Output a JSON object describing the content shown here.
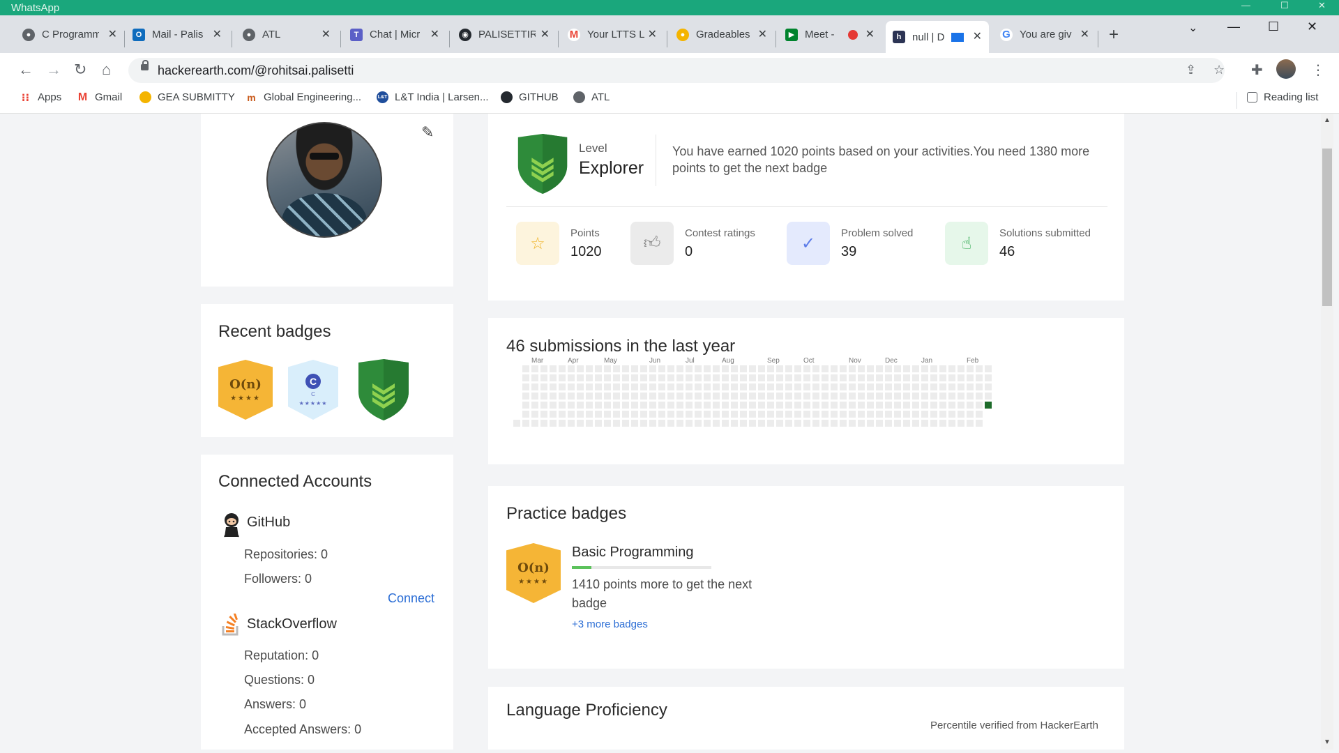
{
  "window": {
    "title_bar_app": "WhatsApp"
  },
  "tabs": [
    {
      "title": "C Programm",
      "favicon": "globe-icon",
      "color": "#5f6368"
    },
    {
      "title": "Mail - Palis",
      "favicon": "outlook-icon",
      "color": "#0f6cbd"
    },
    {
      "title": "ATL",
      "favicon": "globe-icon",
      "color": "#5f6368"
    },
    {
      "title": "Chat | Micr",
      "favicon": "teams-icon",
      "color": "#5b5fc7"
    },
    {
      "title": "PALISETTIR",
      "favicon": "github-icon",
      "color": "#24292f"
    },
    {
      "title": "Your LTTS L",
      "favicon": "gmail-icon",
      "color": "#ea4335"
    },
    {
      "title": "Gradeables",
      "favicon": "duck-icon",
      "color": "#f4b400"
    },
    {
      "title": "Meet -",
      "favicon": "meet-icon",
      "color": "#00832d"
    },
    {
      "title": "null | D",
      "favicon": "hackerearth-icon",
      "color": "#2c3454",
      "active": true
    },
    {
      "title": "You are giv",
      "favicon": "google-icon",
      "color": "#4285f4"
    }
  ],
  "address_bar": {
    "url": "hackerearth.com/@rohitsai.palisetti"
  },
  "bookmarks": [
    {
      "label": "Apps",
      "icon": "apps-grid-icon"
    },
    {
      "label": "Gmail",
      "icon": "gmail-icon"
    },
    {
      "label": "GEA SUBMITTY",
      "icon": "duck-icon"
    },
    {
      "label": "Global Engineering...",
      "icon": "ltts-icon"
    },
    {
      "label": "L&T India | Larsen...",
      "icon": "lt-icon"
    },
    {
      "label": "GITHUB",
      "icon": "github-icon"
    },
    {
      "label": "ATL",
      "icon": "globe-icon"
    }
  ],
  "reading_list": "Reading list",
  "level": {
    "label": "Level",
    "name": "Explorer",
    "message": "You have earned 1020 points based on your activities.You need 1380 more points to get the next badge"
  },
  "stats": [
    {
      "label": "Points",
      "value": "1020",
      "icon": "star-icon"
    },
    {
      "label": "Contest ratings",
      "value": "0",
      "icon": "thumbs-up-icon"
    },
    {
      "label": "Problem solved",
      "value": "39",
      "icon": "check-circle-icon"
    },
    {
      "label": "Solutions submitted",
      "value": "46",
      "icon": "pointer-hand-icon"
    }
  ],
  "submissions": {
    "title": "46 submissions in the last year",
    "months": [
      "Mar",
      "Apr",
      "May",
      "Jun",
      "Jul",
      "Aug",
      "Sep",
      "Oct",
      "Nov",
      "Dec",
      "Jan",
      "Feb"
    ]
  },
  "recent_badges": {
    "title": "Recent badges",
    "items": [
      {
        "type": "gold-hex",
        "text": "O(n)",
        "stars": "★★★★"
      },
      {
        "type": "blue-hex",
        "text": "C",
        "sub": "C",
        "stars": "★★★★★"
      },
      {
        "type": "green-shield"
      }
    ]
  },
  "practice_badges": {
    "title": "Practice badges",
    "badge_text": "O(n)",
    "badge_stars": "★★★★",
    "name": "Basic Programming",
    "progress": 0.14,
    "message_line1": "1410 points more to get the next",
    "message_line2": "badge",
    "more": "+3 more badges"
  },
  "connected_accounts": {
    "title": "Connected Accounts",
    "github": {
      "name": "GitHub",
      "repositories": "Repositories: 0",
      "followers": "Followers: 0",
      "connect": "Connect"
    },
    "stackoverflow": {
      "name": "StackOverflow",
      "reputation": "Reputation: 0",
      "questions": "Questions: 0",
      "answers": "Answers: 0",
      "accepted": "Accepted Answers: 0"
    }
  },
  "language": {
    "title": "Language Proficiency",
    "note": "Percentile verified from HackerEarth"
  },
  "colors": {
    "accent_green": "#2e8b3a",
    "link_blue": "#2c6ed5",
    "badge_gold": "#f5b536",
    "window_green": "#1aa77c"
  }
}
